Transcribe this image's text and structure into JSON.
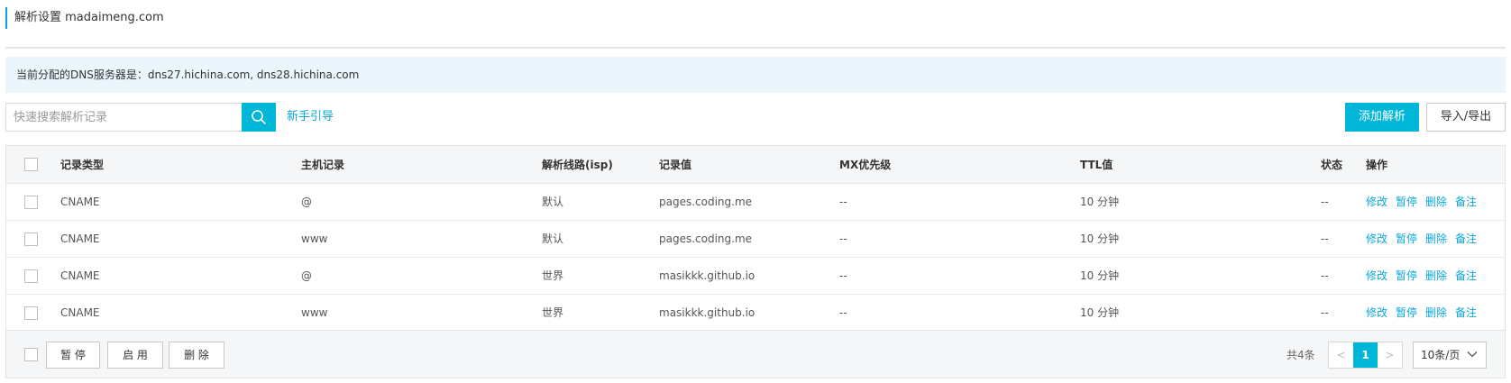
{
  "page_title": "解析设置 madaimeng.com",
  "dns_info": "当前分配的DNS服务器是：dns27.hichina.com, dns28.hichina.com",
  "search": {
    "placeholder": "快速搜索解析记录",
    "icon": "search-icon"
  },
  "guide_link": "新手引导",
  "toolbar": {
    "add_label": "添加解析",
    "import_export_label": "导入/导出"
  },
  "colors": {
    "accent": "#00b6d8",
    "link": "#0ba6d8",
    "info_bg": "#eaf6fc"
  },
  "table": {
    "headers": {
      "type": "记录类型",
      "host": "主机记录",
      "line": "解析线路(isp)",
      "value": "记录值",
      "mx": "MX优先级",
      "ttl": "TTL值",
      "status": "状态",
      "ops": "操作"
    },
    "rows": [
      {
        "type": "CNAME",
        "host": "@",
        "line": "默认",
        "value": "pages.coding.me",
        "mx": "--",
        "ttl": "10 分钟",
        "status": "--"
      },
      {
        "type": "CNAME",
        "host": "www",
        "line": "默认",
        "value": "pages.coding.me",
        "mx": "--",
        "ttl": "10 分钟",
        "status": "--"
      },
      {
        "type": "CNAME",
        "host": "@",
        "line": "世界",
        "value": "masikkk.github.io",
        "mx": "--",
        "ttl": "10 分钟",
        "status": "--"
      },
      {
        "type": "CNAME",
        "host": "www",
        "line": "世界",
        "value": "masikkk.github.io",
        "mx": "--",
        "ttl": "10 分钟",
        "status": "--"
      }
    ],
    "row_actions": {
      "edit": "修改",
      "pause": "暂停",
      "delete": "删除",
      "note": "备注"
    }
  },
  "footer": {
    "pause_label": "暂 停",
    "enable_label": "启 用",
    "delete_label": "删 除",
    "total": "共4条",
    "pagination": {
      "prev": "<",
      "current": "1",
      "next": ">"
    },
    "page_size": "10条/页"
  }
}
